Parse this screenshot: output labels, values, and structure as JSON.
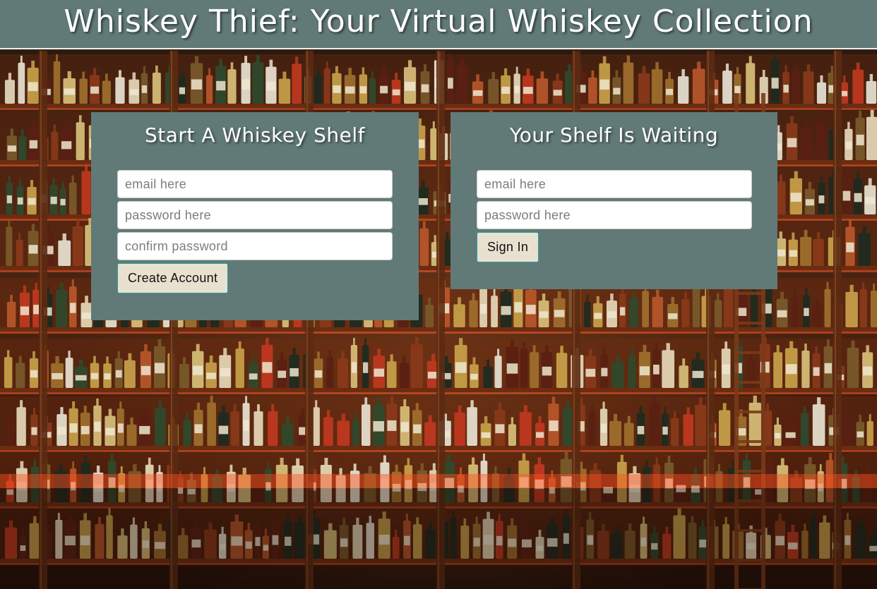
{
  "header": {
    "title": "Whiskey Thief: Your Virtual Whiskey Collection"
  },
  "signup": {
    "heading": "Start A Whiskey Shelf",
    "email_placeholder": "email here",
    "password_placeholder": "password here",
    "confirm_placeholder": "confirm password",
    "submit_label": "Create Account"
  },
  "signin": {
    "heading": "Your Shelf Is Waiting",
    "email_placeholder": "email here",
    "password_placeholder": "password here",
    "submit_label": "Sign In"
  },
  "colors": {
    "header_bg": "#617a77",
    "panel_bg": "#617a77",
    "button_bg": "#e8e1cf",
    "button_border": "#27a0a0"
  },
  "background": {
    "subject": "bar shelves stocked with whiskey bottles"
  }
}
